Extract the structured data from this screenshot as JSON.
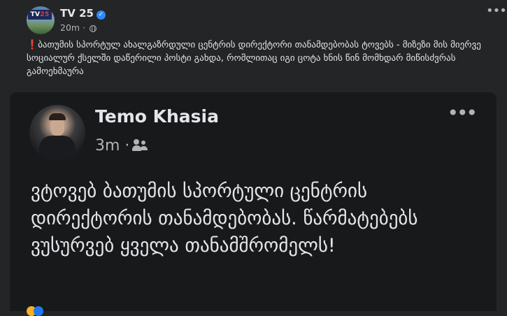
{
  "post": {
    "page_name": "TV 25",
    "logo_text_a": "TV",
    "logo_text_b": "25",
    "time": "20m ·",
    "more_label": "•••",
    "alert_mark": "❗",
    "text": "ბათუმის სპორტულ ახალგაზრდული ცენტრის დირექტორი თანამდებობას ტოვებს - მიზეზი მის მიერვე სოციალურ ქსელში დაწერილი პოსტი გახდა, რომლითაც იგი ცოტა ხნის წინ მომხდარ მიწისძვრას გამოეხმაურა"
  },
  "shared": {
    "author": "Temo Khasia",
    "time": "3m ·",
    "more_label": "•••",
    "text": "ვტოვებ ბათუმის სპორტული ცენტრის დირექტორის თანამდებობას. წარმატებებს ვუსურვებ ყველა თანამშრომელს!"
  },
  "colors": {
    "background": "#242526",
    "card": "#18191a",
    "text": "#e4e6eb",
    "secondary": "#b0b3b8",
    "verified": "#2d88ff",
    "alert": "#e53935"
  },
  "icons": [
    "verified-badge-icon",
    "globe-icon",
    "friends-icon",
    "more-options-icon"
  ]
}
